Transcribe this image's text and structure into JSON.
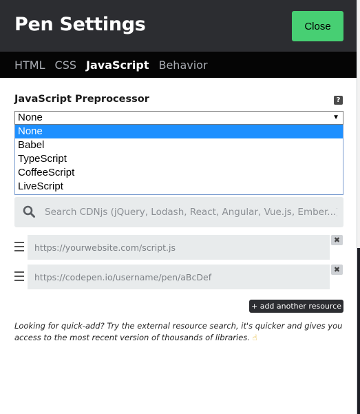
{
  "header": {
    "title": "Pen Settings",
    "close_label": "Close"
  },
  "tabs": [
    {
      "label": "HTML",
      "active": false
    },
    {
      "label": "CSS",
      "active": false
    },
    {
      "label": "JavaScript",
      "active": true
    },
    {
      "label": "Behavior",
      "active": false
    }
  ],
  "preprocessor": {
    "label": "JavaScript Preprocessor",
    "help_icon": "?",
    "selected": "None",
    "options": [
      "None",
      "Babel",
      "TypeScript",
      "CoffeeScript",
      "LiveScript"
    ]
  },
  "search": {
    "placeholder": "Search CDNjs (jQuery, Lodash, React, Angular, Vue.js, Ember...)",
    "icon": "search-icon"
  },
  "resources": [
    {
      "placeholder": "https://yourwebsite.com/script.js",
      "remove": "✖"
    },
    {
      "placeholder": "https://codepen.io/username/pen/aBcDef",
      "remove": "✖"
    }
  ],
  "add_resource_label": "+ add another resource",
  "help_text": "Looking for quick-add? Try the external resource search, it's quicker and gives you access to the most recent version of thousands of libraries.",
  "help_emoji": "☝",
  "colors": {
    "header_bg": "#2c2d31",
    "tabs_bg": "#050505",
    "accent_green": "#47cf73",
    "selected_option": "#1e90ff",
    "input_bg": "#e8ebec"
  }
}
